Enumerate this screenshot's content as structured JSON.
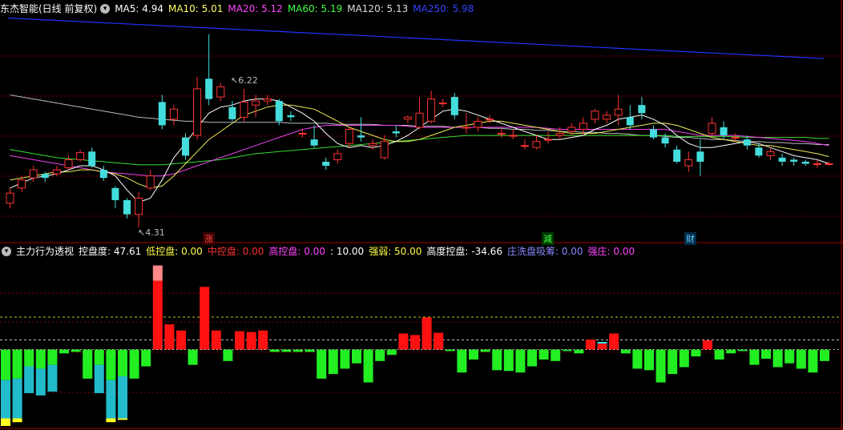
{
  "top": {
    "title": "东杰智能(日线 前复权)",
    "ma": [
      {
        "label": "MA5: 4.94",
        "color": "#ffffff"
      },
      {
        "label": "MA10: 5.01",
        "color": "#ffff66"
      },
      {
        "label": "MA20: 5.12",
        "color": "#ff44ff"
      },
      {
        "label": "MA60: 5.19",
        "color": "#44ff44"
      },
      {
        "label": "MA120: 5.13",
        "color": "#dddddd"
      },
      {
        "label": "MA250: 5.98",
        "color": "#3344ff"
      }
    ],
    "high_label": "6.22",
    "low_label": "4.31",
    "event_tags": [
      {
        "text": "涨",
        "color": "#ff4444"
      },
      {
        "text": "減",
        "color": "#44ff44"
      },
      {
        "text": "财",
        "color": "#66ccff"
      }
    ]
  },
  "bottom": {
    "title": "主力行为透视",
    "items": [
      {
        "label": "控盘度: 47.61",
        "color": "#ffffff"
      },
      {
        "label": "低控盘: 0.00",
        "color": "#ffff44"
      },
      {
        "label": "中控盘: 0.00",
        "color": "#ff3333"
      },
      {
        "label": "高控盘: 0.00",
        "color": "#ff44ff"
      },
      {
        "label": ": 10.00",
        "color": "#ffffff"
      },
      {
        "label": "强弱: 50.00",
        "color": "#ffff44"
      },
      {
        "label": "高度控盘: -34.66",
        "color": "#ffffff"
      },
      {
        "label": "庄洗盘吸筹: 0.00",
        "color": "#8888ff"
      },
      {
        "label": "强庄: 0.00",
        "color": "#ff44ff"
      }
    ]
  },
  "colors": {
    "up": "#ff3333",
    "down": "#44dddd",
    "ma250": "#2233ff",
    "grid": "#8b0000"
  },
  "chart_data": {
    "type": "candlestick",
    "candles": [
      [
        4.55,
        4.65,
        4.7,
        4.5
      ],
      [
        4.7,
        4.78,
        4.82,
        4.66
      ],
      [
        4.8,
        4.88,
        4.92,
        4.76
      ],
      [
        4.84,
        4.8,
        4.86,
        4.76
      ],
      [
        4.84,
        4.88,
        4.92,
        4.82
      ],
      [
        4.9,
        4.98,
        5.02,
        4.88
      ],
      [
        4.98,
        5.05,
        5.08,
        4.96
      ],
      [
        5.06,
        4.92,
        5.1,
        4.9
      ],
      [
        4.88,
        4.8,
        4.92,
        4.77
      ],
      [
        4.7,
        4.58,
        4.72,
        4.5
      ],
      [
        4.58,
        4.44,
        4.6,
        4.4
      ],
      [
        4.44,
        4.6,
        4.66,
        4.31
      ],
      [
        4.7,
        4.82,
        4.88,
        4.68
      ],
      [
        5.55,
        5.32,
        5.62,
        5.28
      ],
      [
        5.38,
        5.48,
        5.52,
        5.32
      ],
      [
        5.2,
        5.02,
        5.24,
        4.98
      ],
      [
        5.22,
        5.68,
        5.8,
        5.18
      ],
      [
        5.78,
        5.58,
        6.22,
        5.52
      ],
      [
        5.6,
        5.7,
        5.74,
        5.56
      ],
      [
        5.5,
        5.38,
        5.56,
        5.36
      ],
      [
        5.4,
        5.55,
        5.68,
        5.36
      ],
      [
        5.52,
        5.56,
        5.62,
        5.4
      ],
      [
        5.56,
        5.58,
        5.62,
        5.52
      ],
      [
        5.56,
        5.36,
        5.58,
        5.32
      ],
      [
        5.42,
        5.4,
        5.46,
        5.36
      ],
      [
        5.24,
        5.24,
        5.28,
        5.2
      ],
      [
        5.18,
        5.12,
        5.32,
        5.1
      ],
      [
        4.96,
        4.92,
        5.0,
        4.88
      ],
      [
        4.98,
        5.04,
        5.08,
        4.94
      ],
      [
        5.14,
        5.28,
        5.3,
        5.1
      ],
      [
        5.22,
        5.2,
        5.4,
        5.16
      ],
      [
        5.12,
        5.14,
        5.18,
        5.08
      ],
      [
        5.0,
        5.16,
        5.22,
        4.98
      ],
      [
        5.26,
        5.24,
        5.32,
        5.2
      ],
      [
        5.38,
        5.4,
        5.42,
        5.34
      ],
      [
        5.3,
        5.44,
        5.6,
        5.28
      ],
      [
        5.36,
        5.58,
        5.66,
        5.34
      ],
      [
        5.54,
        5.54,
        5.58,
        5.5
      ],
      [
        5.6,
        5.42,
        5.64,
        5.38
      ],
      [
        5.3,
        5.3,
        5.44,
        5.24
      ],
      [
        5.3,
        5.36,
        5.4,
        5.26
      ],
      [
        5.38,
        5.38,
        5.42,
        5.34
      ],
      [
        5.24,
        5.24,
        5.28,
        5.2
      ],
      [
        5.22,
        5.22,
        5.28,
        5.18
      ],
      [
        5.12,
        5.12,
        5.18,
        5.08
      ],
      [
        5.1,
        5.16,
        5.22,
        5.08
      ],
      [
        5.18,
        5.18,
        5.26,
        5.14
      ],
      [
        5.22,
        5.24,
        5.3,
        5.18
      ],
      [
        5.26,
        5.3,
        5.34,
        5.22
      ],
      [
        5.28,
        5.34,
        5.4,
        5.24
      ],
      [
        5.38,
        5.46,
        5.48,
        5.34
      ],
      [
        5.38,
        5.42,
        5.46,
        5.34
      ],
      [
        5.42,
        5.48,
        5.62,
        5.32
      ],
      [
        5.4,
        5.32,
        5.52,
        5.28
      ],
      [
        5.52,
        5.44,
        5.6,
        5.38
      ],
      [
        5.28,
        5.2,
        5.32,
        5.18
      ],
      [
        5.2,
        5.14,
        5.24,
        5.1
      ],
      [
        5.08,
        4.96,
        5.12,
        4.94
      ],
      [
        4.92,
        4.98,
        5.06,
        4.86
      ],
      [
        5.06,
        4.96,
        5.18,
        4.82
      ],
      [
        5.24,
        5.34,
        5.4,
        5.22
      ],
      [
        5.3,
        5.22,
        5.36,
        5.18
      ],
      [
        5.2,
        5.2,
        5.24,
        5.16
      ],
      [
        5.18,
        5.12,
        5.22,
        5.08
      ],
      [
        5.1,
        5.02,
        5.14,
        5.0
      ],
      [
        5.02,
        5.06,
        5.1,
        4.98
      ],
      [
        5.0,
        4.96,
        5.04,
        4.92
      ],
      [
        4.98,
        4.96,
        5.0,
        4.92
      ],
      [
        4.96,
        4.94,
        4.98,
        4.92
      ],
      [
        4.94,
        4.94,
        4.98,
        4.9
      ],
      [
        4.94,
        4.94,
        4.96,
        4.92
      ]
    ],
    "price_range": [
      4.2,
      6.4
    ],
    "ma5": [
      4.7,
      4.75,
      4.8,
      4.82,
      4.84,
      4.88,
      4.92,
      4.92,
      4.88,
      4.82,
      4.68,
      4.56,
      4.6,
      4.78,
      5.0,
      5.14,
      5.3,
      5.44,
      5.5,
      5.52,
      5.56,
      5.58,
      5.58,
      5.56,
      5.5,
      5.44,
      5.36,
      5.24,
      5.14,
      5.1,
      5.12,
      5.1,
      5.12,
      5.16,
      5.22,
      5.3,
      5.38,
      5.46,
      5.48,
      5.46,
      5.42,
      5.38,
      5.34,
      5.3,
      5.26,
      5.22,
      5.18,
      5.18,
      5.2,
      5.22,
      5.28,
      5.32,
      5.38,
      5.4,
      5.42,
      5.38,
      5.32,
      5.22,
      5.14,
      5.1,
      5.1,
      5.12,
      5.14,
      5.16,
      5.14,
      5.1,
      5.06,
      5.02,
      5.0,
      4.98,
      4.94
    ],
    "ma10": [
      4.78,
      4.8,
      4.82,
      4.84,
      4.86,
      4.86,
      4.88,
      4.88,
      4.86,
      4.84,
      4.8,
      4.74,
      4.7,
      4.72,
      4.82,
      4.94,
      5.06,
      5.18,
      5.26,
      5.34,
      5.42,
      5.46,
      5.5,
      5.52,
      5.52,
      5.5,
      5.48,
      5.42,
      5.36,
      5.3,
      5.26,
      5.22,
      5.18,
      5.16,
      5.16,
      5.18,
      5.22,
      5.26,
      5.3,
      5.32,
      5.34,
      5.36,
      5.36,
      5.34,
      5.32,
      5.3,
      5.28,
      5.26,
      5.24,
      5.24,
      5.24,
      5.26,
      5.28,
      5.3,
      5.32,
      5.34,
      5.34,
      5.32,
      5.28,
      5.24,
      5.2,
      5.18,
      5.16,
      5.14,
      5.12,
      5.12,
      5.1,
      5.08,
      5.06,
      5.04,
      5.01
    ],
    "ma20": [
      5.02,
      5.0,
      4.98,
      4.96,
      4.94,
      4.92,
      4.9,
      4.88,
      4.86,
      4.85,
      4.84,
      4.83,
      4.82,
      4.82,
      4.84,
      4.88,
      4.92,
      4.96,
      5.0,
      5.04,
      5.08,
      5.12,
      5.16,
      5.2,
      5.24,
      5.28,
      5.3,
      5.32,
      5.32,
      5.32,
      5.32,
      5.32,
      5.32,
      5.32,
      5.31,
      5.3,
      5.3,
      5.3,
      5.3,
      5.3,
      5.3,
      5.3,
      5.3,
      5.3,
      5.3,
      5.3,
      5.29,
      5.28,
      5.28,
      5.28,
      5.28,
      5.28,
      5.28,
      5.28,
      5.28,
      5.28,
      5.28,
      5.26,
      5.24,
      5.22,
      5.22,
      5.22,
      5.22,
      5.21,
      5.2,
      5.19,
      5.18,
      5.17,
      5.16,
      5.14,
      5.12
    ],
    "ma60": [
      5.08,
      5.06,
      5.04,
      5.02,
      5.0,
      4.99,
      4.98,
      4.97,
      4.96,
      4.95,
      4.94,
      4.93,
      4.93,
      4.93,
      4.94,
      4.95,
      4.96,
      4.97,
      4.98,
      5.0,
      5.02,
      5.04,
      5.05,
      5.06,
      5.07,
      5.08,
      5.09,
      5.1,
      5.11,
      5.12,
      5.13,
      5.14,
      5.15,
      5.16,
      5.17,
      5.18,
      5.19,
      5.2,
      5.21,
      5.22,
      5.22,
      5.22,
      5.22,
      5.22,
      5.22,
      5.22,
      5.22,
      5.22,
      5.22,
      5.22,
      5.22,
      5.22,
      5.22,
      5.22,
      5.22,
      5.22,
      5.22,
      5.21,
      5.21,
      5.21,
      5.21,
      5.21,
      5.21,
      5.2,
      5.2,
      5.2,
      5.2,
      5.2,
      5.2,
      5.19,
      5.19
    ],
    "ma120": [
      5.62,
      5.6,
      5.58,
      5.56,
      5.54,
      5.52,
      5.5,
      5.48,
      5.46,
      5.44,
      5.42,
      5.4,
      5.39,
      5.38,
      5.37,
      5.36,
      5.36,
      5.35,
      5.35,
      5.35,
      5.35,
      5.35,
      5.35,
      5.35,
      5.34,
      5.34,
      5.34,
      5.34,
      5.33,
      5.33,
      5.33,
      5.33,
      5.32,
      5.32,
      5.32,
      5.31,
      5.31,
      5.31,
      5.3,
      5.3,
      5.3,
      5.29,
      5.29,
      5.28,
      5.28,
      5.27,
      5.27,
      5.26,
      5.26,
      5.25,
      5.25,
      5.24,
      5.24,
      5.23,
      5.22,
      5.22,
      5.21,
      5.2,
      5.2,
      5.19,
      5.18,
      5.18,
      5.17,
      5.16,
      5.16,
      5.15,
      5.15,
      5.14,
      5.14,
      5.13,
      5.13
    ],
    "ma250_start": 6.38,
    "ma250_end": 5.98,
    "indicator": {
      "range": [
        -100,
        120
      ],
      "values": [
        -100,
        -95,
        -57,
        -60,
        -55,
        -5,
        -3,
        -38,
        -57,
        -95,
        -92,
        -38,
        -22,
        110,
        33,
        25,
        -20,
        82,
        25,
        -15,
        24,
        23,
        25,
        -3,
        -3,
        -3,
        -3,
        -38,
        -32,
        -25,
        -18,
        -43,
        -15,
        -7,
        21,
        19,
        42,
        22,
        -2,
        -30,
        -13,
        -3,
        -27,
        -28,
        -30,
        -22,
        -13,
        -15,
        -2,
        -5,
        13,
        8,
        21,
        -5,
        -25,
        -27,
        -43,
        -32,
        -23,
        -9,
        12,
        -13,
        -5,
        -2,
        -20,
        -12,
        -23,
        -18,
        -25,
        -30,
        -15
      ],
      "cyan_top": [
        -40,
        -38,
        -22,
        -25,
        -20,
        0,
        0,
        0,
        -20,
        -40,
        -35,
        0,
        0,
        12,
        12,
        10,
        0,
        10,
        10,
        10,
        10,
        10,
        10,
        10,
        10,
        10,
        10,
        10,
        10,
        10,
        10,
        10,
        10,
        10,
        10,
        10,
        10,
        10,
        10,
        10,
        10,
        10,
        10,
        0,
        0,
        0,
        0,
        0,
        0,
        0,
        10,
        10,
        10,
        10,
        0,
        0,
        0,
        0,
        0,
        0,
        0,
        10,
        10,
        10,
        10,
        0,
        0,
        0,
        0,
        0,
        0
      ],
      "levels": [
        0,
        12.5,
        42.5
      ]
    }
  }
}
